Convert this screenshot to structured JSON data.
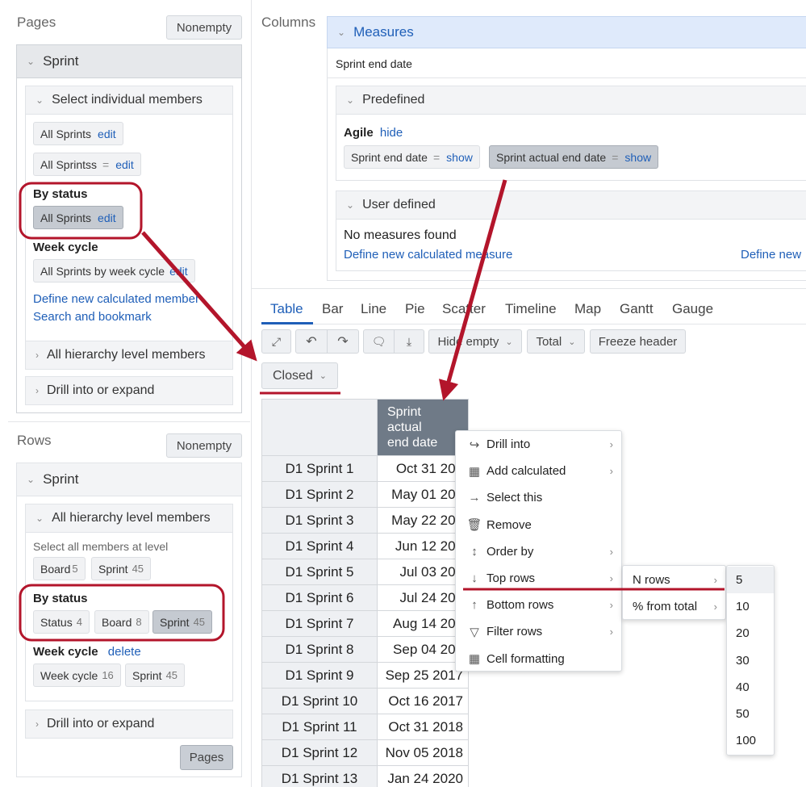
{
  "pages": {
    "title": "Pages",
    "nonempty": "Nonempty",
    "sprint_header": "Sprint",
    "select_individual": "Select individual members",
    "all_sprints": "All Sprints",
    "edit": "edit",
    "all_sprintss": "All Sprintss",
    "eq": "=",
    "by_status": "By status",
    "week_cycle": "Week cycle",
    "all_sprints_week": "All Sprints by week cycle",
    "edit_trunc": "edit",
    "define_new": "Define new calculated member",
    "search_bookmark": "Search and bookmark",
    "all_hierarchy": "All hierarchy level members",
    "drill_into": "Drill into or expand"
  },
  "rows": {
    "title": "Rows",
    "nonempty": "Nonempty",
    "sprint_header": "Sprint",
    "all_hierarchy": "All hierarchy level members",
    "select_all_level": "Select all members at level",
    "board": "Board",
    "board_n": "5",
    "sprint": "Sprint",
    "sprint_n": "45",
    "by_status": "By status",
    "status": "Status",
    "status_n": "4",
    "board2": "Board",
    "board2_n": "8",
    "sprint2": "Sprint",
    "sprint2_n": "45",
    "week_cycle": "Week cycle",
    "delete": "delete",
    "week_cycle_chip": "Week cycle",
    "week_cycle_n": "16",
    "sprint3": "Sprint",
    "sprint3_n": "45",
    "drill_into": "Drill into or expand",
    "pages_btn": "Pages"
  },
  "columns": {
    "title": "Columns",
    "measures": "Measures",
    "sprint_end_date": "Sprint end date",
    "predefined": "Predefined",
    "agile": "Agile",
    "hide": "hide",
    "chip1": "Sprint end date",
    "chip2": "Sprint actual end date",
    "show": "show",
    "eq": "=",
    "user_defined": "User defined",
    "no_measures": "No measures found",
    "define_new_measure": "Define new calculated measure",
    "define_new_trunc": "Define new"
  },
  "tabs": [
    "Table",
    "Bar",
    "Line",
    "Pie",
    "Scatter",
    "Timeline",
    "Map",
    "Gantt",
    "Gauge"
  ],
  "toolbar": {
    "hide_empty": "Hide empty",
    "total": "Total",
    "freeze_header": "Freeze header",
    "closed": "Closed"
  },
  "table": {
    "col_header_lines": [
      "Sprint",
      "actual",
      "end date"
    ],
    "rows": [
      {
        "label": "D1 Sprint 1",
        "value": "Oct 31 201"
      },
      {
        "label": "D1 Sprint 2",
        "value": "May 01 201"
      },
      {
        "label": "D1 Sprint 3",
        "value": "May 22 201"
      },
      {
        "label": "D1 Sprint 4",
        "value": "Jun 12 201"
      },
      {
        "label": "D1 Sprint 5",
        "value": "Jul 03 201"
      },
      {
        "label": "D1 Sprint 6",
        "value": "Jul 24 201"
      },
      {
        "label": "D1 Sprint 7",
        "value": "Aug 14 201"
      },
      {
        "label": "D1 Sprint 8",
        "value": "Sep 04 201"
      },
      {
        "label": "D1 Sprint 9",
        "value": "Sep 25 2017"
      },
      {
        "label": "D1 Sprint 10",
        "value": "Oct 16 2017"
      },
      {
        "label": "D1 Sprint 11",
        "value": "Oct 31 2018"
      },
      {
        "label": "D1 Sprint 12",
        "value": "Nov 05 2018"
      },
      {
        "label": "D1 Sprint 13",
        "value": "Jan 24 2020"
      }
    ]
  },
  "context_menu": {
    "items": [
      {
        "label": "Drill into",
        "icon": "share-icon",
        "submenu": true
      },
      {
        "label": "Add calculated",
        "icon": "calculator-icon",
        "submenu": true
      },
      {
        "label": "Select this",
        "icon": "arrow-right-icon",
        "submenu": false
      },
      {
        "label": "Remove",
        "icon": "trash-icon",
        "submenu": false
      },
      {
        "label": "Order by",
        "icon": "sort-icon",
        "submenu": true
      },
      {
        "label": "Top rows",
        "icon": "arrow-down-icon",
        "submenu": true
      },
      {
        "label": "Bottom rows",
        "icon": "arrow-up-icon",
        "submenu": true
      },
      {
        "label": "Filter rows",
        "icon": "filter-icon",
        "submenu": true
      },
      {
        "label": "Cell formatting",
        "icon": "table-icon",
        "submenu": false
      }
    ],
    "submenu": [
      "N rows",
      "% from total"
    ],
    "n_values": [
      "5",
      "10",
      "20",
      "30",
      "40",
      "50",
      "100"
    ]
  },
  "colors": {
    "link": "#1f5fb8",
    "annotation": "#b3152b",
    "column_header": "#6f7a87"
  }
}
